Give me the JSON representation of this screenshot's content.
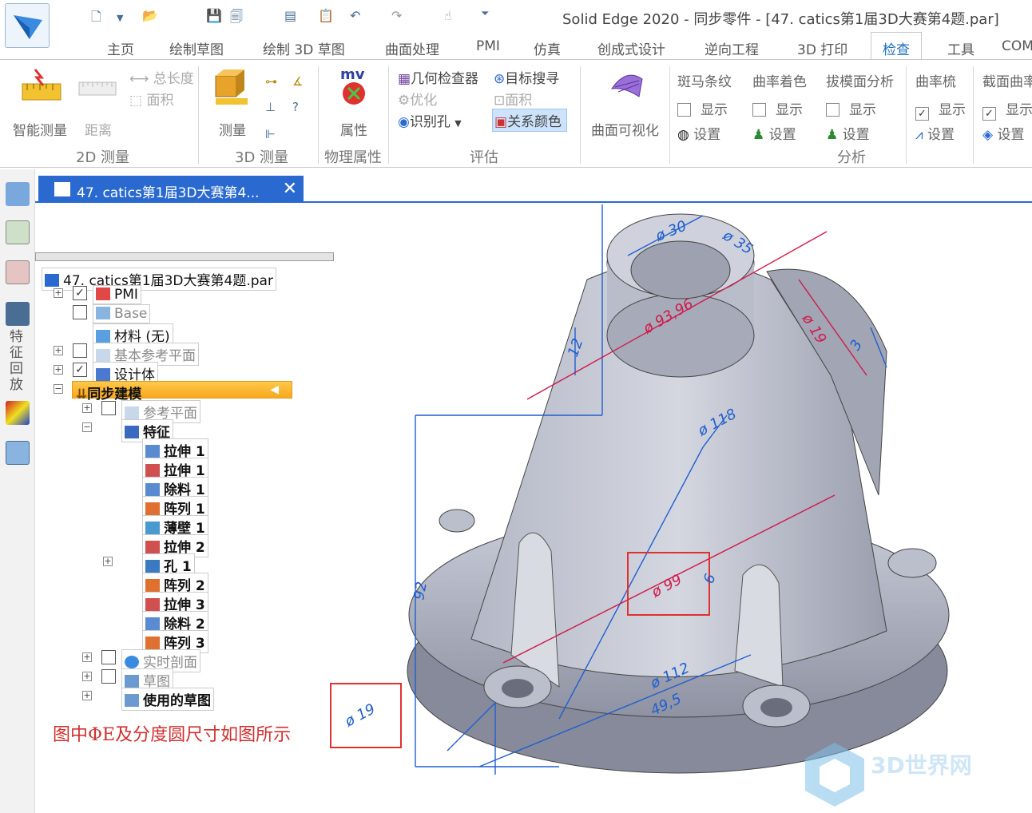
{
  "window": {
    "title": "Solid Edge 2020 - 同步零件 - [47. catics第1届3D大赛第4题.par]"
  },
  "tabs": [
    "主页",
    "绘制草图",
    "绘制 3D 草图",
    "曲面处理",
    "PMI",
    "仿真",
    "创成式设计",
    "逆向工程",
    "3D 打印",
    "检查",
    "工具",
    "COMS"
  ],
  "active_tab": "检查",
  "ribbon": {
    "smart_measure": "智能测量",
    "distance": "距离",
    "total_length": "总长度",
    "area": "面积",
    "group_2d": "2D 测量",
    "measure": "测量",
    "group_3d": "3D 测量",
    "properties": "属性",
    "group_phys": "物理属性",
    "geom_checker": "几何检查器",
    "optimize": "优化",
    "recognize_holes": "识别孔",
    "target_search": "目标搜寻",
    "area2": "面积",
    "relation_color": "关系颜色",
    "group_eval": "评估",
    "surface_vis": "曲面可视化",
    "zebra": "斑马条纹",
    "curv_shade": "曲率着色",
    "draft": "拔模面分析",
    "curv_comb": "曲率梳",
    "section_curv": "截面曲率",
    "show": "显示",
    "settings": "设置",
    "group_analysis": "分析"
  },
  "doc_tab": "47. catics第1届3D大赛第4...",
  "tree": {
    "root": "47. catics第1届3D大赛第4题.par",
    "pmi": "PMI",
    "base": "Base",
    "material": "材料 (无)",
    "ref_planes": "基本参考平面",
    "design_body": "设计体",
    "sync": "同步建模",
    "sync_ref": "参考平面",
    "features": "特征",
    "f1": "拉伸 1",
    "f2": "拉伸 1",
    "f3": "除料 1",
    "f4": "阵列 1",
    "f5": "薄壁 1",
    "f6": "拉伸 2",
    "f7": "孔 1",
    "f8": "阵列 2",
    "f9": "拉伸 3",
    "f10": "除料 2",
    "f11": "阵列 3",
    "live_section": "实时剖面",
    "sketch": "草图",
    "used_sketch": "使用的草图"
  },
  "left_strip_label": "特征回放",
  "note": "图中ΦE及分度圆尺寸如图所示",
  "dims": {
    "d30": "ø 30",
    "d35": "ø 35",
    "d9396": "ø 93,96",
    "d19a": "ø 19",
    "d12": "12",
    "d118": "ø 118",
    "d99": "ø 99",
    "d112": "ø 112",
    "d495": "49,5",
    "d92": "92",
    "d19": "ø 19",
    "d6": "6",
    "d3": "3"
  },
  "watermark": "3D世界网"
}
